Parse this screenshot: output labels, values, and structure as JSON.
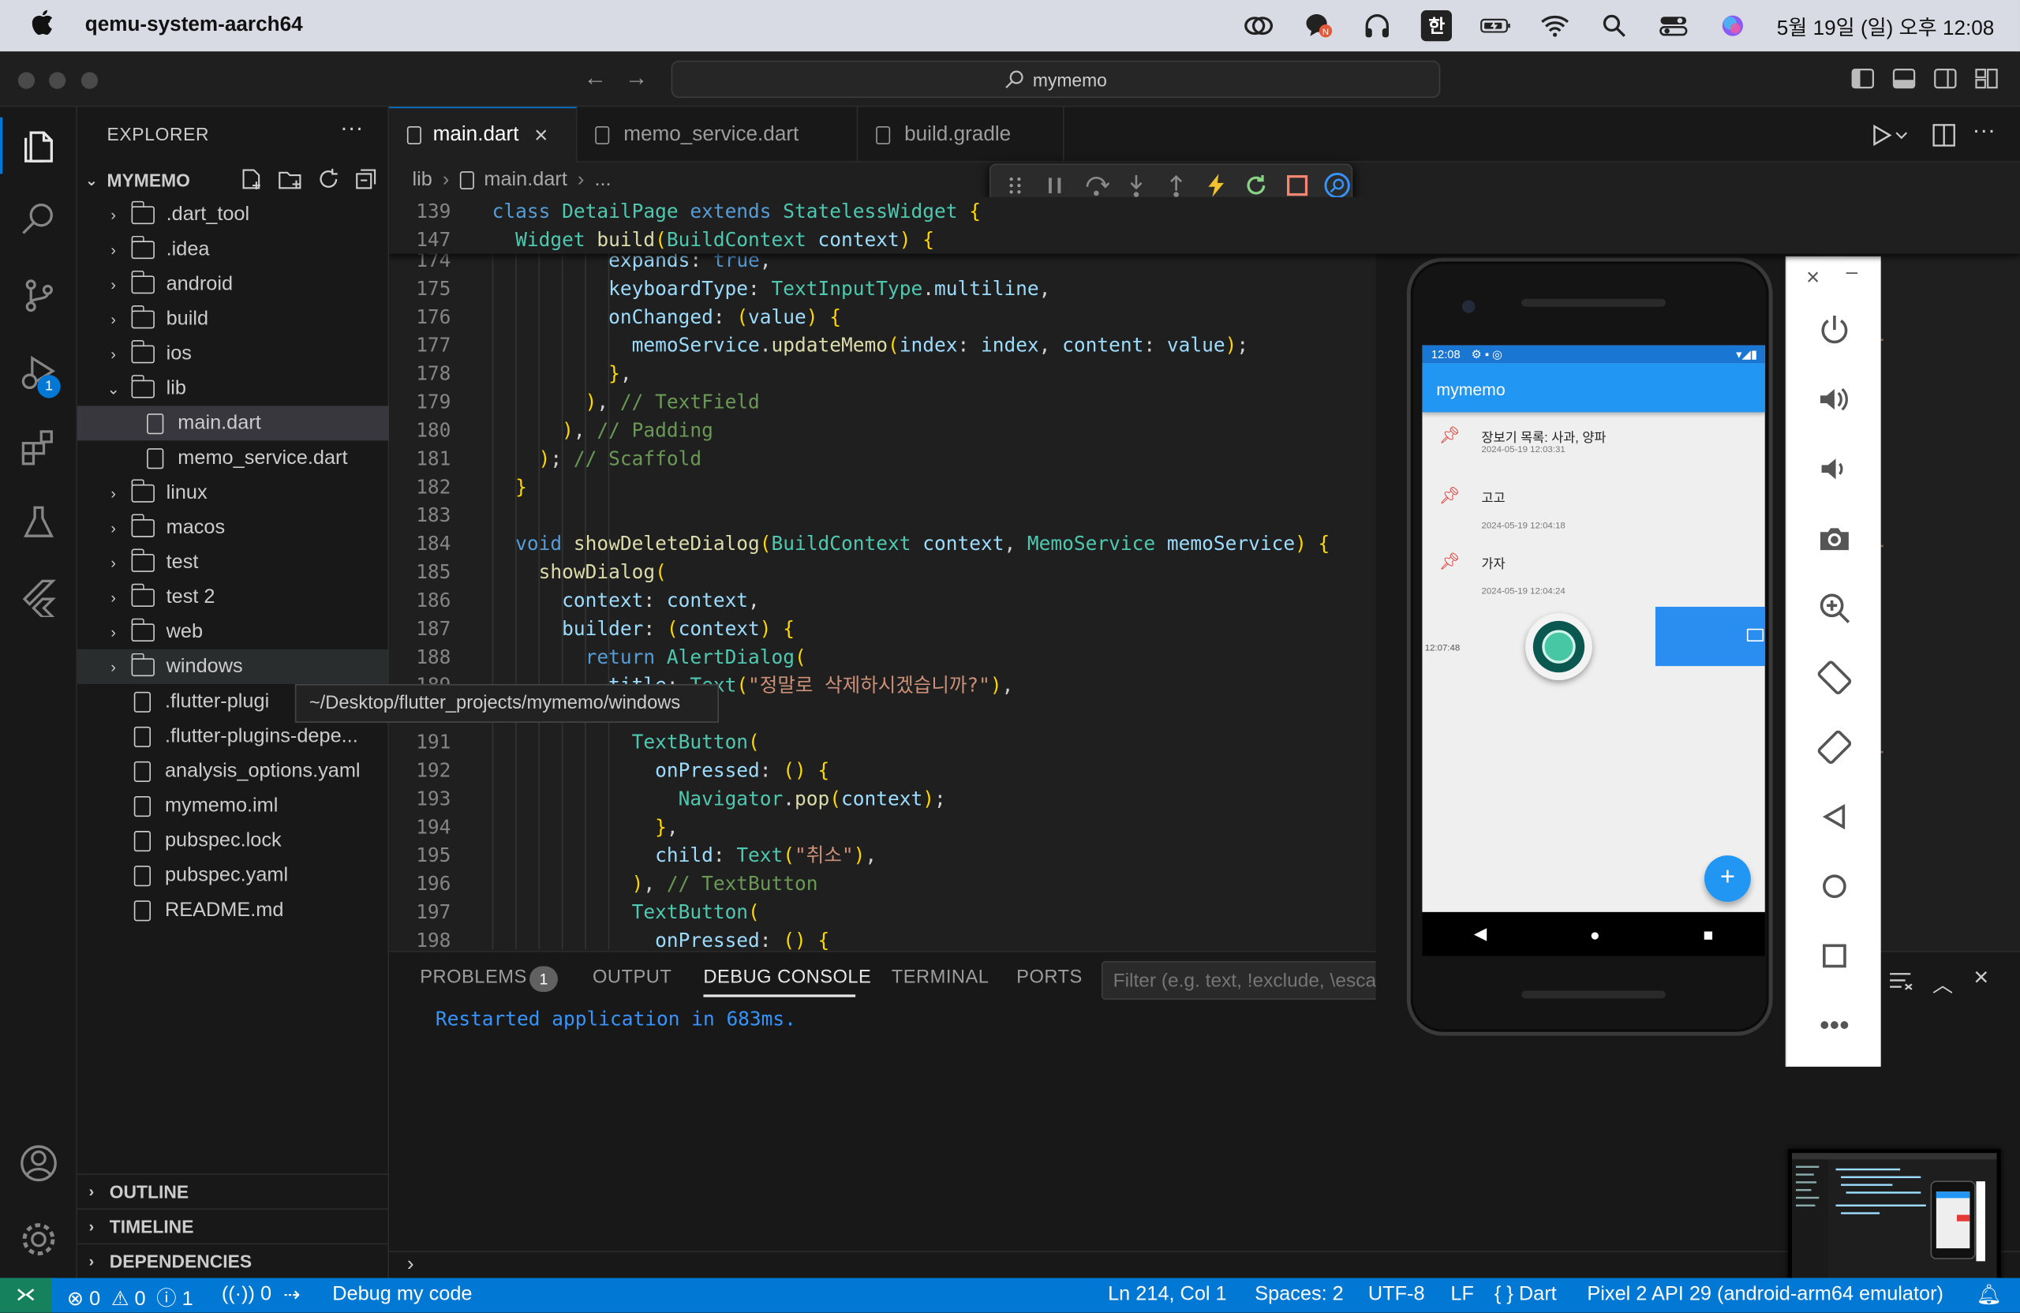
{
  "menubar": {
    "app_name": "qemu-system-aarch64",
    "ime": "한",
    "datetime": "5월 19일 (일) 오후 12:08"
  },
  "titlebar": {
    "search": "mymemo"
  },
  "explorer": {
    "title": "EXPLORER",
    "project": "MYMEMO",
    "items": [
      {
        "name": ".dart_tool",
        "type": "folder"
      },
      {
        "name": ".idea",
        "type": "folder"
      },
      {
        "name": "android",
        "type": "folder"
      },
      {
        "name": "build",
        "type": "folder"
      },
      {
        "name": "ios",
        "type": "folder"
      },
      {
        "name": "lib",
        "type": "folder-open"
      },
      {
        "name": "main.dart",
        "type": "file"
      },
      {
        "name": "memo_service.dart",
        "type": "file"
      },
      {
        "name": "linux",
        "type": "folder"
      },
      {
        "name": "macos",
        "type": "folder"
      },
      {
        "name": "test",
        "type": "folder"
      },
      {
        "name": "test 2",
        "type": "folder"
      },
      {
        "name": "web",
        "type": "folder"
      },
      {
        "name": "windows",
        "type": "folder"
      },
      {
        "name": ".flutter-plugi",
        "type": "file"
      },
      {
        "name": ".flutter-plugins-depe...",
        "type": "file"
      },
      {
        "name": "analysis_options.yaml",
        "type": "file"
      },
      {
        "name": "mymemo.iml",
        "type": "file"
      },
      {
        "name": "pubspec.lock",
        "type": "file"
      },
      {
        "name": "pubspec.yaml",
        "type": "file"
      },
      {
        "name": "README.md",
        "type": "file"
      }
    ],
    "tooltip": "~/Desktop/flutter_projects/mymemo/windows",
    "sections": [
      "OUTLINE",
      "TIMELINE",
      "DEPENDENCIES"
    ],
    "debug_badge": "1"
  },
  "tabs": [
    {
      "label": "main.dart",
      "active": true
    },
    {
      "label": "memo_service.dart",
      "active": false
    },
    {
      "label": "build.gradle",
      "active": false
    }
  ],
  "breadcrumb": {
    "folder": "lib",
    "file": "main.dart",
    "more": "..."
  },
  "sticky": [
    {
      "ln": "139",
      "code": "class DetailPage extends StatelessWidget {"
    },
    {
      "ln": "147",
      "code": "  Widget build(BuildContext context) {"
    }
  ],
  "code_lines": [
    {
      "ln": "174",
      "code": "          expands: true,"
    },
    {
      "ln": "175",
      "code": "          keyboardType: TextInputType.multiline,"
    },
    {
      "ln": "176",
      "code": "          onChanged: (value) {"
    },
    {
      "ln": "177",
      "code": "            memoService.updateMemo(index: index, content: value);"
    },
    {
      "ln": "178",
      "code": "          },"
    },
    {
      "ln": "179",
      "code": "        ), // TextField"
    },
    {
      "ln": "180",
      "code": "      ), // Padding"
    },
    {
      "ln": "181",
      "code": "    ); // Scaffold"
    },
    {
      "ln": "182",
      "code": "  }"
    },
    {
      "ln": "183",
      "code": ""
    },
    {
      "ln": "184",
      "code": "  void showDeleteDialog(BuildContext context, MemoService memoService) {"
    },
    {
      "ln": "185",
      "code": "    showDialog("
    },
    {
      "ln": "186",
      "code": "      context: context,"
    },
    {
      "ln": "187",
      "code": "      builder: (context) {"
    },
    {
      "ln": "188",
      "code": "        return AlertDialog("
    },
    {
      "ln": "189",
      "code": "          title: Text(\"정말로 삭제하시겠습니까?\"),"
    },
    {
      "ln": "190",
      "code": ""
    },
    {
      "ln": "191",
      "code": "            TextButton("
    },
    {
      "ln": "192",
      "code": "              onPressed: () {"
    },
    {
      "ln": "193",
      "code": "                Navigator.pop(context);"
    },
    {
      "ln": "194",
      "code": "              },"
    },
    {
      "ln": "195",
      "code": "              child: Text(\"취소\"),"
    },
    {
      "ln": "196",
      "code": "            ), // TextButton"
    },
    {
      "ln": "197",
      "code": "            TextButton("
    },
    {
      "ln": "198",
      "code": "              onPressed: () {"
    }
  ],
  "panel": {
    "tabs": [
      "PROBLEMS",
      "OUTPUT",
      "DEBUG CONSOLE",
      "TERMINAL",
      "PORTS"
    ],
    "problems_count": "1",
    "filter_placeholder": "Filter (e.g. text, !exclude, \\escape)",
    "output": "Restarted application in 683ms."
  },
  "phone": {
    "status_time": "12:08",
    "app_title": "mymemo",
    "memos": [
      {
        "text": "장보기 목록: 사과, 양파",
        "time": "2024-05-19 12:03:31"
      },
      {
        "text": "고고",
        "time": "2024-05-19 12:04:18"
      },
      {
        "text": "가자",
        "time": "2024-05-19 12:04:24"
      }
    ],
    "overlay_time": "12:07:48",
    "fab": "+"
  },
  "statusbar": {
    "errors": "0",
    "warnings": "0",
    "info": "1",
    "ports": "0",
    "debug": "Debug my code",
    "position": "Ln 214, Col 1",
    "spaces": "Spaces: 2",
    "encoding": "UTF-8",
    "eol": "LF",
    "language": "Dart",
    "device": "Pixel 2 API 29 (android-arm64 emulator)"
  },
  "colors": {
    "accent": "#0078d4",
    "appbar": "#2196f3",
    "statusbar": "#0078d4"
  }
}
